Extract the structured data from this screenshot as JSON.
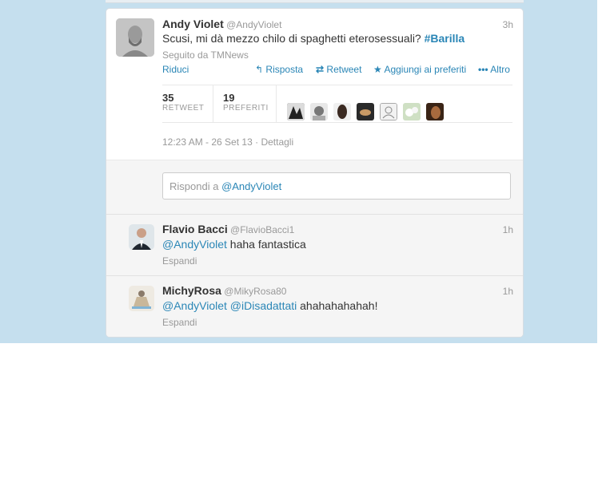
{
  "main_tweet": {
    "name": "Andy Violet",
    "handle": "@AndyViolet",
    "time": "3h",
    "text": "Scusi, mi dà mezzo chilo di spaghetti eterosessuali?",
    "hashtag": "#Barilla",
    "followed_by": "Seguito da TMNews",
    "collapse": "Riduci",
    "actions": {
      "reply": "Risposta",
      "retweet": "Retweet",
      "favorite": "Aggiungi ai preferiti",
      "more": "Altro"
    },
    "stats": {
      "retweets_count": "35",
      "retweets_label": "RETWEET",
      "favorites_count": "19",
      "favorites_label": "PREFERITI"
    },
    "timestamp": "12:23 AM - 26 Set 13",
    "separator": "·",
    "details": "Dettagli"
  },
  "reply_input": {
    "prefix": "Rispondi a",
    "mention": "@AndyViolet"
  },
  "replies": [
    {
      "name": "Flavio Bacci",
      "handle": "@FlavioBacci1",
      "time": "1h",
      "mention": "@AndyViolet",
      "text": "haha fantastica",
      "expand": "Espandi"
    },
    {
      "name": "MichyRosa",
      "handle": "@MikyRosa80",
      "time": "1h",
      "mention1": "@AndyViolet",
      "mention2": "@iDisadattati",
      "text": "ahahahahahah!",
      "expand": "Espandi"
    }
  ],
  "colors": {
    "background": "#c5dfee",
    "link": "#2a86b6",
    "muted": "#999999"
  }
}
